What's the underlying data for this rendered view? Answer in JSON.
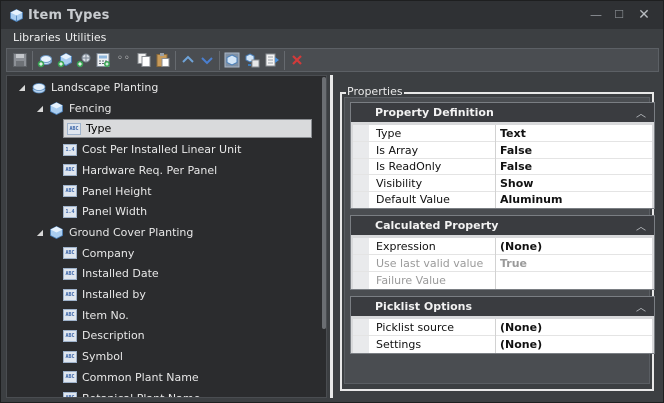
{
  "window": {
    "title": "Item Types",
    "controls": {
      "minimize": "—",
      "maximize": "☐",
      "close": "✕"
    }
  },
  "menu": {
    "items": [
      "Libraries",
      "Utilities"
    ]
  },
  "toolbar": {
    "icons": [
      "save-icon",
      "add-library-icon",
      "add-item-type-icon",
      "add-property-icon",
      "add-calculated-icon",
      "ellipsis-icon",
      "copy-icon",
      "paste-icon",
      "move-up-icon",
      "move-down-icon",
      "import-icon",
      "export-icon",
      "export-excel-icon",
      "delete-icon"
    ],
    "ellipsis": "◦◦"
  },
  "tree": {
    "items": [
      {
        "label": "Landscape Planting",
        "level": 0,
        "expanded": true,
        "kind": "library"
      },
      {
        "label": "Fencing",
        "level": 1,
        "expanded": true,
        "kind": "item-type"
      },
      {
        "label": "Type",
        "level": 2,
        "kind": "string",
        "selected": true
      },
      {
        "label": "Cost Per Installed Linear Unit",
        "level": 2,
        "kind": "number"
      },
      {
        "label": "Hardware Req. Per Panel",
        "level": 2,
        "kind": "string"
      },
      {
        "label": "Panel Height",
        "level": 2,
        "kind": "string"
      },
      {
        "label": "Panel Width",
        "level": 2,
        "kind": "number"
      },
      {
        "label": "Ground Cover Planting",
        "level": 1,
        "expanded": true,
        "kind": "item-type"
      },
      {
        "label": "Company",
        "level": 2,
        "kind": "string"
      },
      {
        "label": "Installed Date",
        "level": 2,
        "kind": "string"
      },
      {
        "label": "Installed by",
        "level": 2,
        "kind": "string"
      },
      {
        "label": "Item No.",
        "level": 2,
        "kind": "string"
      },
      {
        "label": "Description",
        "level": 2,
        "kind": "string"
      },
      {
        "label": "Symbol",
        "level": 2,
        "kind": "string"
      },
      {
        "label": "Common Plant Name",
        "level": 2,
        "kind": "string"
      },
      {
        "label": "Botanical Plant Name",
        "level": 2,
        "kind": "string"
      }
    ],
    "icon_text": {
      "string": "ABC",
      "number": "1.4"
    }
  },
  "properties": {
    "legend": "Properties",
    "groups": [
      {
        "title": "Property Definition",
        "rows": [
          {
            "name": "Type",
            "value": "Text",
            "disabled": false
          },
          {
            "name": "Is Array",
            "value": "False",
            "disabled": false
          },
          {
            "name": "Is ReadOnly",
            "value": "False",
            "disabled": false
          },
          {
            "name": "Visibility",
            "value": "Show",
            "disabled": false
          },
          {
            "name": "Default Value",
            "value": "Aluminum",
            "disabled": false
          }
        ]
      },
      {
        "title": "Calculated Property",
        "rows": [
          {
            "name": "Expression",
            "value": "(None)",
            "disabled": false
          },
          {
            "name": "Use last valid value",
            "value": "True",
            "disabled": true
          },
          {
            "name": "Failure Value",
            "value": "",
            "disabled": true
          }
        ]
      },
      {
        "title": "Picklist Options",
        "rows": [
          {
            "name": "Picklist source",
            "value": "(None)",
            "disabled": false
          },
          {
            "name": "Settings",
            "value": "(None)",
            "disabled": false
          }
        ]
      }
    ]
  },
  "colors": {
    "accent_blue": "#4a90d9",
    "delete_red": "#d23a3a",
    "background": "#3c3f42"
  }
}
